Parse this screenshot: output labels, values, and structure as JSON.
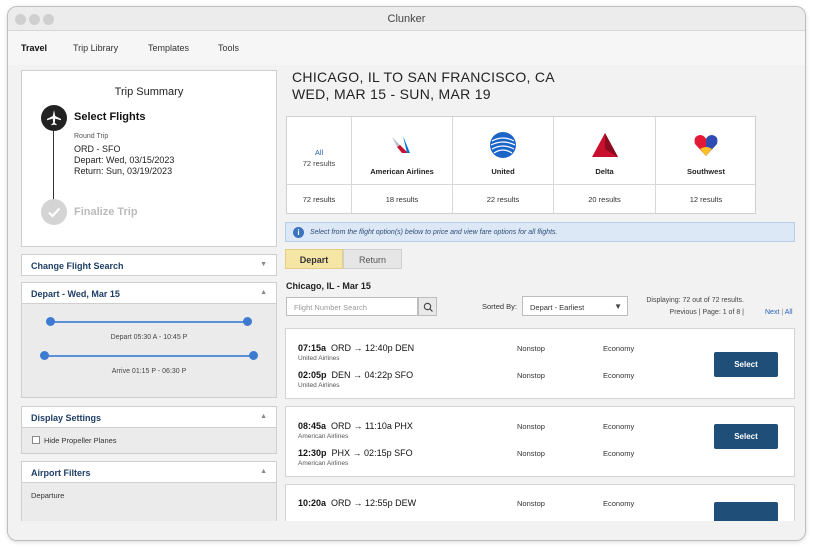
{
  "app": {
    "title": "Clunker"
  },
  "menu": [
    "Travel",
    "Trip Library",
    "Templates",
    "Tools"
  ],
  "trip_summary": {
    "title": "Trip Summary",
    "step1": "Select Flights",
    "trip_type": "Round Trip",
    "route": "ORD - SFO",
    "depart": "Depart: Wed, 03/15/2023",
    "return": "Return: Sun, 03/19/2023",
    "step2": "Finalize Trip"
  },
  "panels": {
    "change_search": "Change Flight Search",
    "depart": "Depart - Wed, Mar 15",
    "depart_range": "Depart 05:30 A - 10:45 P",
    "arrive_range": "Arrive 01:15 P - 06:30 P",
    "display_settings": "Display Settings",
    "hide_prop": "Hide Propeller Planes",
    "airport_filters": "Airport Filters",
    "departure": "Departure"
  },
  "route_title": {
    "line1": "CHICAGO, IL TO SAN FRANCISCO, CA",
    "line2": "WED, MAR 15 - SUN, MAR 19"
  },
  "airlines": {
    "all": {
      "label": "All",
      "results": "72 results",
      "bottom": "72 results"
    },
    "list": [
      {
        "name": "American Airlines",
        "results": "18 results"
      },
      {
        "name": "United",
        "results": "22 results"
      },
      {
        "name": "Delta",
        "results": "20 results"
      },
      {
        "name": "Southwest",
        "results": "12 results"
      }
    ]
  },
  "info_message": "Select from the flight option(s) below to price and view fare options for all flights.",
  "tabs": {
    "depart": "Depart",
    "return": "Return"
  },
  "leg_title": "Chicago, IL - Mar 15",
  "search": {
    "placeholder": "Flight Number Search"
  },
  "sort": {
    "label": "Sorted By:",
    "value": "Depart - Earliest"
  },
  "pager": {
    "displaying": "Displaying: 72 out of 72 results.",
    "page": "Previous | Page: 1 of 8 |",
    "next": "Next",
    "all": "All"
  },
  "flights": [
    {
      "seg1": {
        "dep": "07:15a",
        "route": "ORD → 12:40p DEN",
        "airline": "United Airlines",
        "stops": "Nonstop",
        "cabin": "Economy"
      },
      "seg2": {
        "dep": "02:05p",
        "route": "DEN → 04:22p SFO",
        "airline": "United Airlines",
        "stops": "Nonstop",
        "cabin": "Economy"
      },
      "button": "Select"
    },
    {
      "seg1": {
        "dep": "08:45a",
        "route": "ORD → 11:10a PHX",
        "airline": "American Airlines",
        "stops": "Nonstop",
        "cabin": "Economy"
      },
      "seg2": {
        "dep": "12:30p",
        "route": "PHX → 02:15p SFO",
        "airline": "American Airlines",
        "stops": "Nonstop",
        "cabin": "Economy"
      },
      "button": "Select"
    },
    {
      "seg1": {
        "dep": "10:20a",
        "route": "ORD → 12:55p DEW",
        "airline": "",
        "stops": "Nonstop",
        "cabin": "Economy"
      }
    }
  ],
  "colors": {
    "accent": "#1f4e79",
    "link": "#2b62b7",
    "tab_active": "#f6e6a6",
    "slider": "#3d7bd0"
  }
}
